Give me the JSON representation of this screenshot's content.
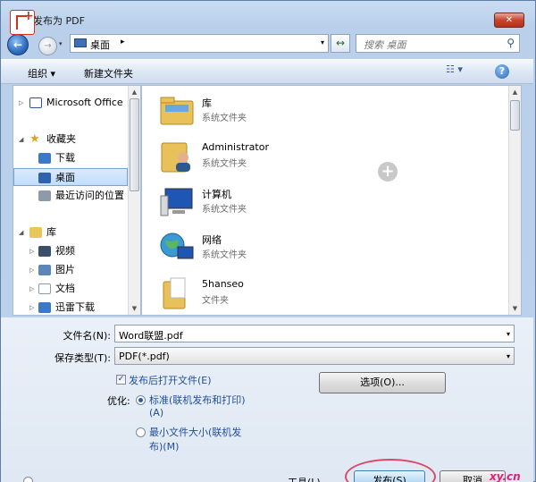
{
  "window": {
    "title": "发布为 PDF",
    "close_label": "✕"
  },
  "nav": {
    "back": "←",
    "forward": "→",
    "address_crumb": "桌面",
    "address_sep": "▸",
    "refresh": "↔",
    "search_placeholder": "搜索 桌面"
  },
  "toolbar": {
    "organize": "组织 ▾",
    "new_folder": "新建文件夹",
    "view": "☷ ▾",
    "help": "?"
  },
  "sidebar": {
    "items": [
      {
        "label": "Microsoft Office",
        "tri": "▷"
      },
      {
        "label": "收藏夹",
        "tri": "◢"
      },
      {
        "label": "下载",
        "tri": ""
      },
      {
        "label": "桌面",
        "tri": ""
      },
      {
        "label": "最近访问的位置",
        "tri": ""
      },
      {
        "label": "库",
        "tri": "◢"
      },
      {
        "label": "视频",
        "tri": "▷"
      },
      {
        "label": "图片",
        "tri": "▷"
      },
      {
        "label": "文档",
        "tri": "▷"
      },
      {
        "label": "迅雷下载",
        "tri": "▷"
      }
    ]
  },
  "files": [
    {
      "name": "库",
      "kind": "系统文件夹"
    },
    {
      "name": "Administrator",
      "kind": "系统文件夹"
    },
    {
      "name": "计算机",
      "kind": "系统文件夹"
    },
    {
      "name": "网络",
      "kind": "系统文件夹"
    },
    {
      "name": "5hanseo",
      "kind": "文件夹"
    }
  ],
  "form": {
    "filename_label": "文件名(N):",
    "filename_value": "Word联盟.pdf",
    "type_label": "保存类型(T):",
    "type_value": "PDF(*.pdf)",
    "open_after_label": "发布后打开文件(E)",
    "options_button": "选项(O)...",
    "optimize_label": "优化:",
    "opt_standard_l1": "标准(联机发布和打印)",
    "opt_standard_l2": "(A)",
    "opt_min_l1": "最小文件大小(联机发",
    "opt_min_l2": "布)(M)"
  },
  "footer": {
    "tools_label": "工具(L)",
    "publish_button": "发布(S)",
    "cancel_button": "取消"
  },
  "scroll": {
    "up": "▲",
    "down": "▼"
  },
  "watermark": "xy.cn",
  "icons": {
    "add": "+",
    "search": "⚲",
    "dropdown": "▾"
  }
}
